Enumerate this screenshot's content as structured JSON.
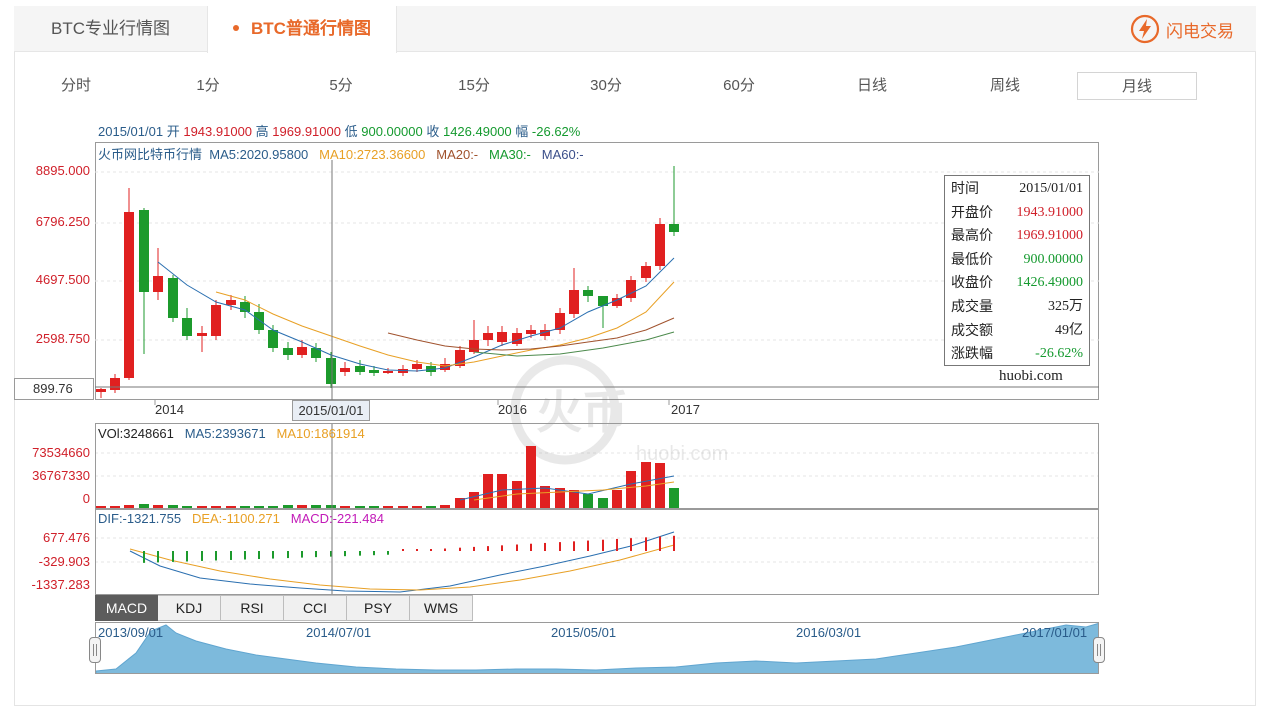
{
  "tabs": {
    "pro": "BTC专业行情图",
    "normal": "BTC普通行情图"
  },
  "brand": {
    "name": "闪电交易",
    "icon": "lightning-icon",
    "color": "#e8692a"
  },
  "periods": [
    "分时",
    "1分",
    "5分",
    "15分",
    "30分",
    "60分",
    "日线",
    "周线",
    "月线"
  ],
  "active_period": "月线",
  "info": {
    "date": "2015/01/01",
    "open_label": "开",
    "open": "1943.91000",
    "high_label": "高",
    "high": "1969.91000",
    "low_label": "低",
    "low": "900.00000",
    "close_label": "收",
    "close": "1426.49000",
    "range_label": "幅",
    "range": "-26.62%"
  },
  "main_legend": {
    "name": "火币网比特币行情",
    "ma5": "MA5:2020.95800",
    "ma10": "MA10:2723.36600",
    "ma20": "MA20:-",
    "ma30": "MA30:-",
    "ma60": "MA60:-"
  },
  "y_labels": [
    "8895.000",
    "6796.250",
    "4697.500",
    "2598.750"
  ],
  "cursor_price": "899.76",
  "x_labels": [
    "2014",
    "2016",
    "2017"
  ],
  "cursor_date": "2015/01/01",
  "tooltip": [
    {
      "k": "时间",
      "v": "2015/01/01",
      "c": "dark"
    },
    {
      "k": "开盘价",
      "v": "1943.91000",
      "c": "red"
    },
    {
      "k": "最高价",
      "v": "1969.91000",
      "c": "red"
    },
    {
      "k": "最低价",
      "v": "900.00000",
      "c": "green"
    },
    {
      "k": "收盘价",
      "v": "1426.49000",
      "c": "green"
    },
    {
      "k": "成交量",
      "v": "325万",
      "c": "dark"
    },
    {
      "k": "成交额",
      "v": "49亿",
      "c": "dark"
    },
    {
      "k": "涨跌幅",
      "v": "-26.62%",
      "c": "green"
    }
  ],
  "site": "huobi.com",
  "watermark": {
    "brand": "火币",
    "site": "huobi.com"
  },
  "volume": {
    "legend_vol": "VOl:3248661",
    "legend_ma5": "MA5:2393671",
    "legend_ma10": "MA10:1861914",
    "y_labels": [
      "73534660",
      "36767330",
      "0"
    ]
  },
  "macd": {
    "legend_dif": "DIF:-1321.755",
    "legend_dea": "DEA:-1100.271",
    "legend_macd": "MACD:-221.484",
    "y_labels": [
      "677.476",
      "-329.903",
      "-1337.283"
    ]
  },
  "indicator_tabs": [
    "MACD",
    "KDJ",
    "RSI",
    "CCI",
    "PSY",
    "WMS"
  ],
  "active_indicator": "MACD",
  "navigator_labels": [
    "2013/09/01",
    "2014/07/01",
    "2015/05/01",
    "2016/03/01",
    "2017/01/01"
  ],
  "colors": {
    "up": "#e02020",
    "down": "#1c9a2c",
    "accent": "#e8692a",
    "nav_fill": "#6fb3d9"
  }
}
